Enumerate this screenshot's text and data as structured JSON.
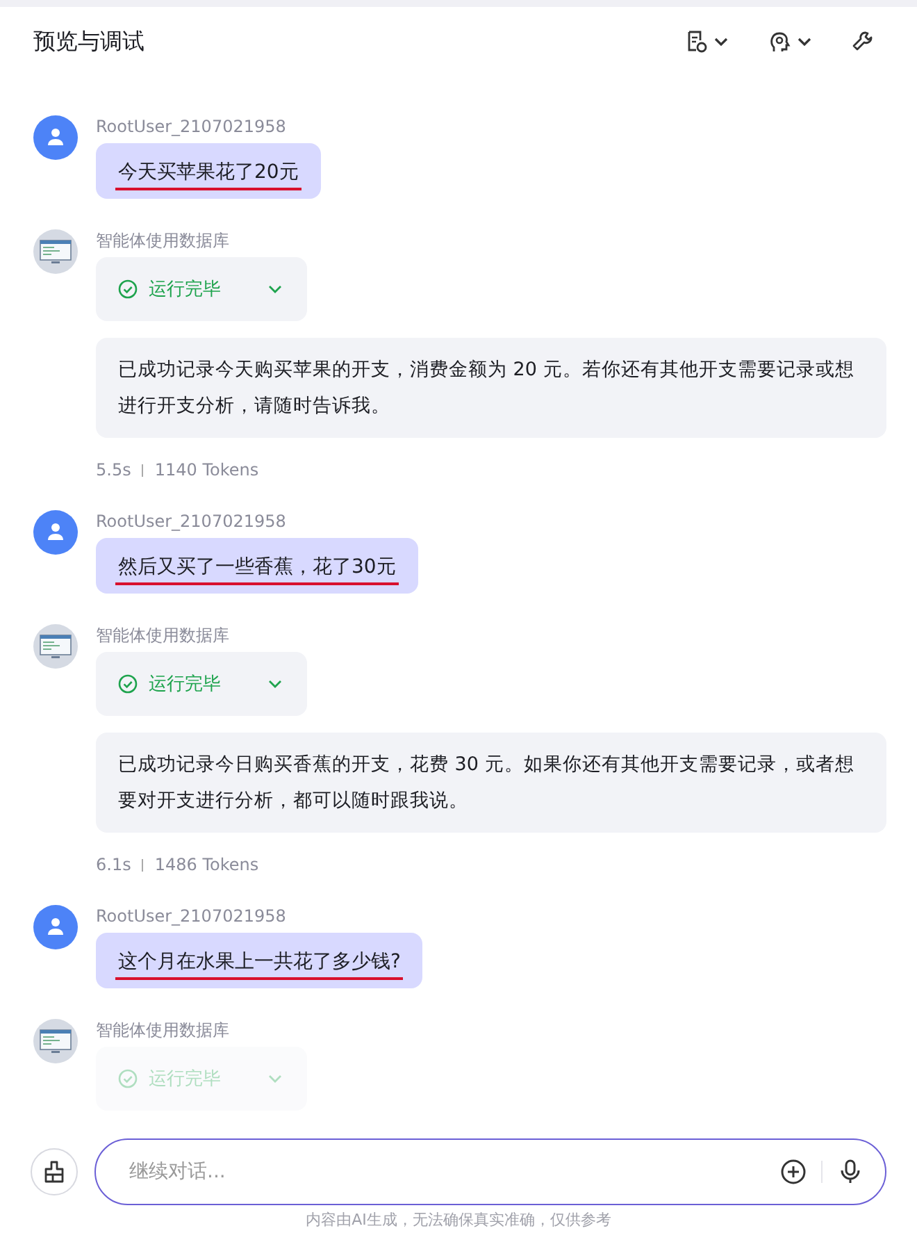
{
  "header": {
    "title": "预览与调试"
  },
  "messages": [
    {
      "kind": "user",
      "author": "RootUser_2107021958",
      "text": "今天买苹果花了20元",
      "underlined": true
    },
    {
      "kind": "bot",
      "author": "智能体使用数据库",
      "status": "运行完毕",
      "faded": false,
      "reply": "已成功记录今天购买苹果的开支，消费金额为 20 元。若你还有其他开支需要记录或想进行开支分析，请随时告诉我。",
      "time": "5.5s",
      "tokens": "1140 Tokens"
    },
    {
      "kind": "user",
      "author": "RootUser_2107021958",
      "text": "然后又买了一些香蕉，花了30元",
      "underlined": true
    },
    {
      "kind": "bot",
      "author": "智能体使用数据库",
      "status": "运行完毕",
      "faded": false,
      "reply": "已成功记录今日购买香蕉的开支，花费 30 元。如果你还有其他开支需要记录，或者想要对开支进行分析，都可以随时跟我说。",
      "time": "6.1s",
      "tokens": "1486 Tokens"
    },
    {
      "kind": "user",
      "author": "RootUser_2107021958",
      "text": "这个月在水果上一共花了多少钱?",
      "underlined": true
    },
    {
      "kind": "bot",
      "author": "智能体使用数据库",
      "status": "运行完毕",
      "faded": true
    }
  ],
  "input": {
    "placeholder": "继续对话..."
  },
  "footer": "内容由AI生成，无法确保真实准确，仅供参考"
}
